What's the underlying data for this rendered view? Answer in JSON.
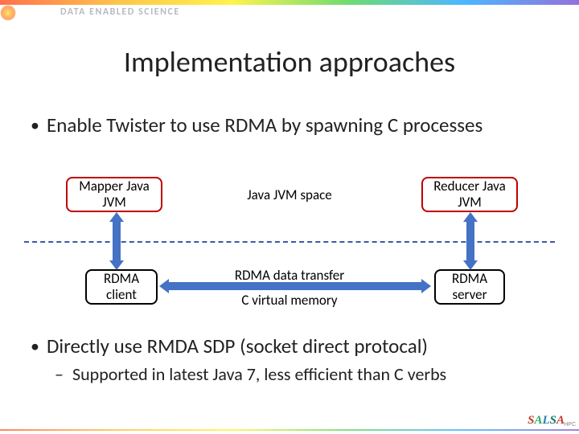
{
  "header": {
    "brand": "Data Enabled Science"
  },
  "title": "Implementation approaches",
  "bullets": {
    "b1": "Enable Twister to use RDMA by spawning C processes",
    "b2": "Directly use RMDA SDP (socket direct protocal)",
    "sub": "Supported in latest Java 7, less efficient than C verbs"
  },
  "diagram": {
    "mapper": "Mapper Java JVM",
    "reducer": "Reducer Java JVM",
    "jvm_space": "Java JVM space",
    "rdma_client": "RDMA client",
    "rdma_server": "RDMA server",
    "rdma_transfer": "RDMA data transfer",
    "c_vmem": "C virtual memory"
  },
  "footer": {
    "logo": "SALSA",
    "sub": "HPC"
  }
}
